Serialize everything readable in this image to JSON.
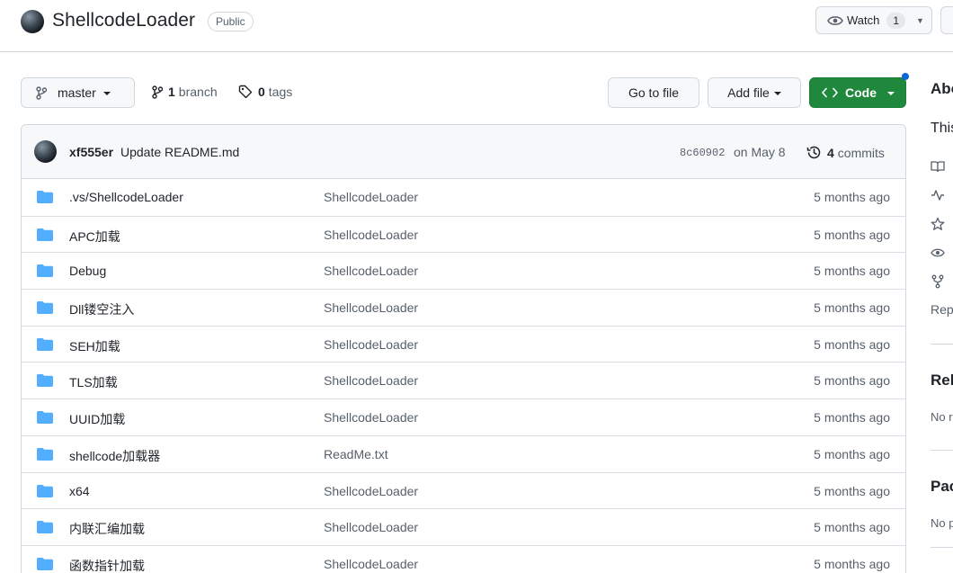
{
  "header": {
    "repo_name": "ShellcodeLoader",
    "visibility": "Public",
    "watch_label": "Watch",
    "watch_count": "1"
  },
  "toolbar": {
    "branch": "master",
    "branch_count": "1",
    "branch_label": "branch",
    "tag_count": "0",
    "tag_label": "tags",
    "go_to_file": "Go to file",
    "add_file": "Add file",
    "code": "Code"
  },
  "commit": {
    "author": "xf555er",
    "message": "Update README.md",
    "sha": "8c60902",
    "date": "on May 8",
    "count": "4",
    "count_label": "commits"
  },
  "files": [
    {
      "name": ".vs/ShellcodeLoader",
      "message": "ShellcodeLoader",
      "age": "5 months ago"
    },
    {
      "name": "APC加载",
      "message": "ShellcodeLoader",
      "age": "5 months ago"
    },
    {
      "name": "Debug",
      "message": "ShellcodeLoader",
      "age": "5 months ago"
    },
    {
      "name": "Dll镂空注入",
      "message": "ShellcodeLoader",
      "age": "5 months ago"
    },
    {
      "name": "SEH加载",
      "message": "ShellcodeLoader",
      "age": "5 months ago"
    },
    {
      "name": "TLS加载",
      "message": "ShellcodeLoader",
      "age": "5 months ago"
    },
    {
      "name": "UUID加载",
      "message": "ShellcodeLoader",
      "age": "5 months ago"
    },
    {
      "name": "shellcode加载器",
      "message": "ReadMe.txt",
      "age": "5 months ago"
    },
    {
      "name": "x64",
      "message": "ShellcodeLoader",
      "age": "5 months ago"
    },
    {
      "name": "内联汇编加载",
      "message": "ShellcodeLoader",
      "age": "5 months ago"
    },
    {
      "name": "函数指针加载",
      "message": "ShellcodeLoader",
      "age": "5 months ago"
    }
  ],
  "sidebar": {
    "about_heading": "Abo",
    "about_text": "This",
    "repo_link": "Rep",
    "releases_heading": "Rel",
    "releases_text": "No r",
    "packages_heading": "Pac",
    "packages_text": "No p"
  },
  "colors": {
    "accent_green": "#1f883d",
    "folder_blue": "#54aeff",
    "notification_blue": "#0969da"
  }
}
